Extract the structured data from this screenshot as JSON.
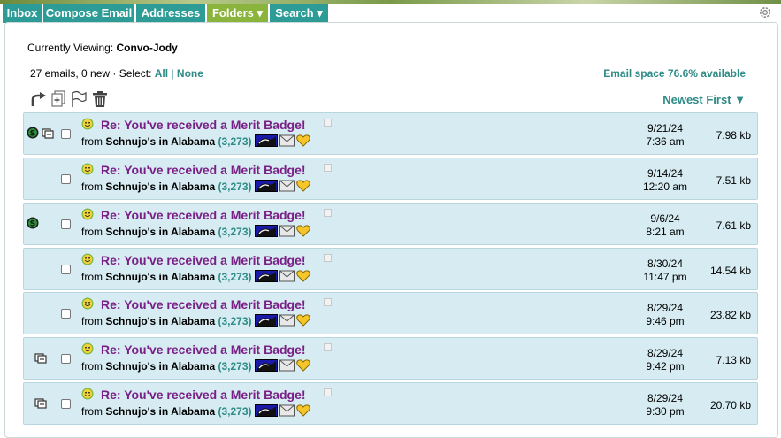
{
  "nav": {
    "tabs": [
      {
        "label": "Inbox"
      },
      {
        "label": "Compose Email"
      },
      {
        "label": "Addresses"
      },
      {
        "label": "Folders ▾"
      },
      {
        "label": "Search ▾"
      }
    ],
    "active_tab": "Folders ▾"
  },
  "header": {
    "viewing_prefix": "Currently Viewing:",
    "viewing_folder": "Convo-Jody",
    "counts": "27 emails, 0 new",
    "select_prefix": "· Select:",
    "select_all": "All",
    "select_sep": "|",
    "select_none": "None",
    "space": "Email space 76.6% available",
    "sort": "Newest First ▼"
  },
  "colors": {
    "tab_bg": "#2e9c96",
    "tab_active_bg": "#8ab43b",
    "link": "#2e8b86",
    "subject": "#7a1f86",
    "row_bg": "#d6ecf2"
  },
  "toolbar_icons": [
    "reply-arrow-icon",
    "add-page-icon",
    "flag-icon",
    "trash-icon"
  ],
  "emails": [
    {
      "icons": [
        "dollar-coin-icon",
        "forward-copy-icon"
      ],
      "subject": "Re: You've received a Merit Badge!",
      "from_prefix": "from",
      "sender": "Schnujo's in Alabama",
      "score": "(3,273)",
      "date": "9/21/24",
      "time": "7:36 am",
      "size": "7.98 kb"
    },
    {
      "icons": [],
      "subject": "Re: You've received a Merit Badge!",
      "from_prefix": "from",
      "sender": "Schnujo's in Alabama",
      "score": "(3,273)",
      "date": "9/14/24",
      "time": "12:20 am",
      "size": "7.51 kb"
    },
    {
      "icons": [
        "dollar-coin-icon"
      ],
      "subject": "Re: You've received a Merit Badge!",
      "from_prefix": "from",
      "sender": "Schnujo's in Alabama",
      "score": "(3,273)",
      "date": "9/6/24",
      "time": "8:21 am",
      "size": "7.61 kb"
    },
    {
      "icons": [],
      "subject": "Re: You've received a Merit Badge!",
      "from_prefix": "from",
      "sender": "Schnujo's in Alabama",
      "score": "(3,273)",
      "date": "8/30/24",
      "time": "11:47 pm",
      "size": "14.54 kb"
    },
    {
      "icons": [],
      "subject": "Re: You've received a Merit Badge!",
      "from_prefix": "from",
      "sender": "Schnujo's in Alabama",
      "score": "(3,273)",
      "date": "8/29/24",
      "time": "9:46 pm",
      "size": "23.82 kb"
    },
    {
      "icons": [
        "forward-copy-icon"
      ],
      "subject": "Re: You've received a Merit Badge!",
      "from_prefix": "from",
      "sender": "Schnujo's in Alabama",
      "score": "(3,273)",
      "date": "8/29/24",
      "time": "9:42 pm",
      "size": "7.13 kb"
    },
    {
      "icons": [
        "forward-copy-icon"
      ],
      "subject": "Re: You've received a Merit Badge!",
      "from_prefix": "from",
      "sender": "Schnujo's in Alabama",
      "score": "(3,273)",
      "date": "8/29/24",
      "time": "9:30 pm",
      "size": "20.70 kb"
    }
  ]
}
